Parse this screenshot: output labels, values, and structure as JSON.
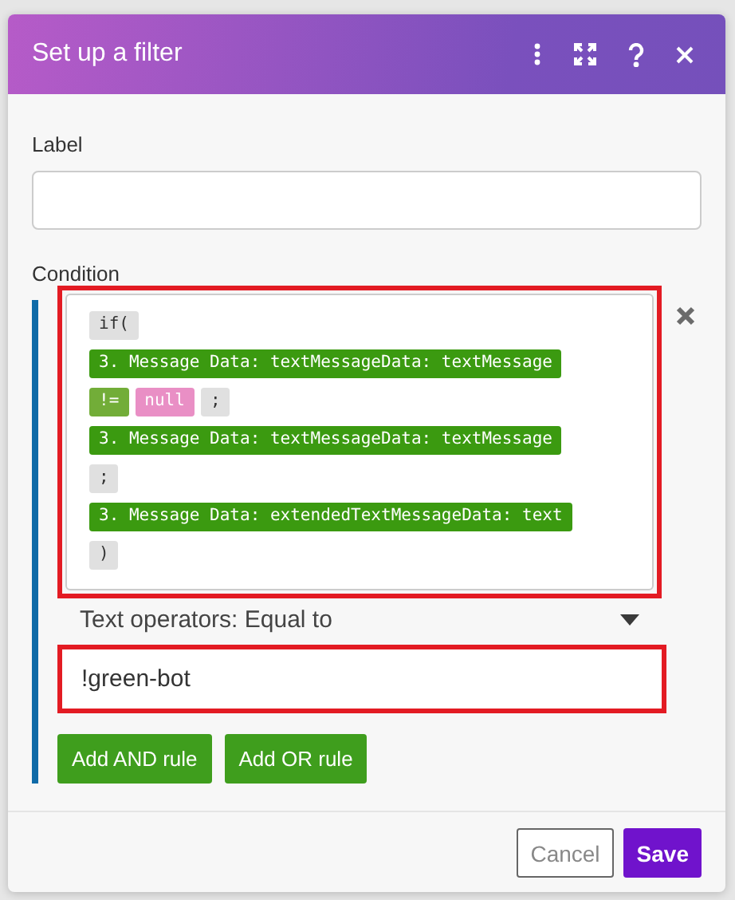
{
  "dialog": {
    "title": "Set up a filter",
    "label_field": {
      "label": "Label"
    },
    "condition": {
      "label": "Condition",
      "highlighted": true,
      "lines": [
        [
          {
            "kind": "keyword",
            "text": "if("
          }
        ],
        [
          {
            "kind": "variable",
            "text": "3. Message Data: textMessageData: textMessage"
          }
        ],
        [
          {
            "kind": "operator",
            "text": "!="
          },
          {
            "kind": "value",
            "text": "null"
          },
          {
            "kind": "keyword",
            "text": ";"
          }
        ],
        [
          {
            "kind": "variable",
            "text": "3. Message Data: textMessageData: textMessage"
          }
        ],
        [
          {
            "kind": "keyword",
            "text": ";"
          }
        ],
        [
          {
            "kind": "variable",
            "text": "3. Message Data: extendedTextMessageData: text"
          }
        ],
        [
          {
            "kind": "keyword",
            "text": ")"
          }
        ]
      ],
      "operator": "Text operators: Equal to",
      "value": "!green-bot",
      "value_highlighted": true
    },
    "rule_buttons": [
      "Add AND rule",
      "Add OR rule"
    ],
    "footer_buttons": [
      {
        "label": "Cancel",
        "kind": "secondary"
      },
      {
        "label": "Save",
        "kind": "primary"
      }
    ]
  }
}
